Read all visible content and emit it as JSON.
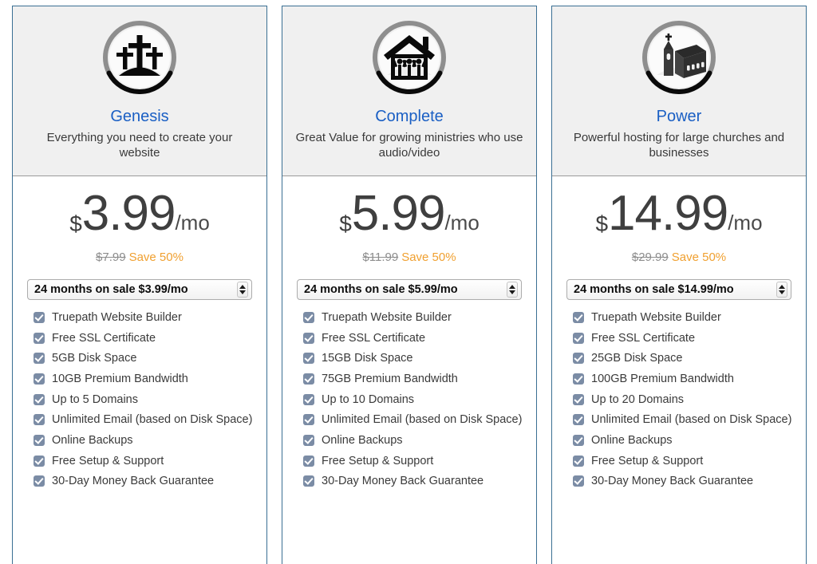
{
  "page": {
    "background_color": "#ffffff",
    "card_border_color": "#3a6f93",
    "header_background_color": "#f0f0f0",
    "plan_name_color": "#1a5fc4",
    "save_badge_color": "#f0a030",
    "checkbox_color": "#7b8ca5"
  },
  "plans": [
    {
      "icon": "three-crosses-on-hill-icon",
      "name": "Genesis",
      "tagline": "Everything you need to create your website",
      "currency": "$",
      "price": "3.99",
      "period": "/mo",
      "old_price": "$7.99",
      "save_label": "Save 50%",
      "term_option": "24 months on sale $3.99/mo",
      "features": [
        "Truepath Website Builder",
        "Free SSL Certificate",
        "5GB Disk Space",
        "10GB Premium Bandwidth",
        "Up to 5 Domains",
        "Unlimited Email (based on Disk Space)",
        "Online Backups",
        "Free Setup & Support",
        "30-Day Money Back Guarantee"
      ]
    },
    {
      "icon": "house-with-people-icon",
      "name": "Complete",
      "tagline": "Great Value for growing ministries who use audio/video",
      "currency": "$",
      "price": "5.99",
      "period": "/mo",
      "old_price": "$11.99",
      "save_label": "Save 50%",
      "term_option": "24 months on sale $5.99/mo",
      "features": [
        "Truepath Website Builder",
        "Free SSL Certificate",
        "15GB Disk Space",
        "75GB Premium Bandwidth",
        "Up to 10 Domains",
        "Unlimited Email (based on Disk Space)",
        "Online Backups",
        "Free Setup & Support",
        "30-Day Money Back Guarantee"
      ]
    },
    {
      "icon": "church-building-icon",
      "name": "Power",
      "tagline": "Powerful hosting for large churches and businesses",
      "currency": "$",
      "price": "14.99",
      "period": "/mo",
      "old_price": "$29.99",
      "save_label": "Save 50%",
      "term_option": "24 months on sale $14.99/mo",
      "features": [
        "Truepath Website Builder",
        "Free SSL Certificate",
        "25GB Disk Space",
        "100GB Premium Bandwidth",
        "Up to 20 Domains",
        "Unlimited Email (based on Disk Space)",
        "Online Backups",
        "Free Setup & Support",
        "30-Day Money Back Guarantee"
      ]
    }
  ]
}
